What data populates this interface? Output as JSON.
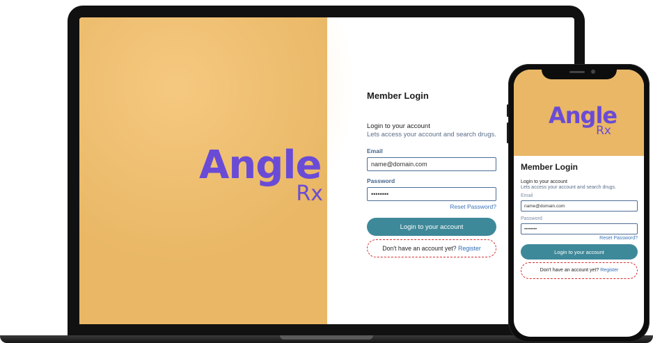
{
  "brand": {
    "name": "Angle",
    "suffix": "Rx",
    "colors": {
      "panel": "#e9b765",
      "logo": "#6a4bd6",
      "button": "#3e8999",
      "link": "#2f6fb5",
      "dashed_outline": "#d22c2c"
    }
  },
  "login": {
    "title": "Member Login",
    "subhead": "Login to your account",
    "description": "Lets access your account and search drugs.",
    "email_label": "Email",
    "email_value": "name@domain.com",
    "password_label": "Password",
    "password_value": "••••••••",
    "reset_link": "Reset Password?",
    "login_button": "Login to your account",
    "register_prompt": "Don't have an account yet?",
    "register_link": "Register"
  }
}
